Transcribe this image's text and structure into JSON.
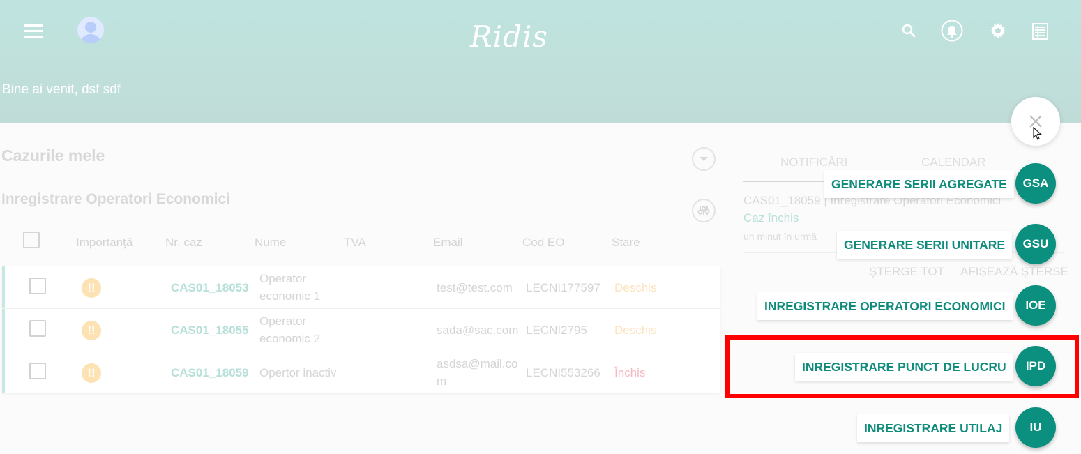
{
  "header": {
    "logo": "Ridis",
    "welcome": "Bine ai venit, dsf sdf"
  },
  "cases": {
    "title": "Cazurile mele",
    "section_title": "Inregistrare Operatori Economici",
    "columns": [
      "Importanță",
      "Nr. caz",
      "Nume",
      "TVA",
      "Email",
      "Cod EO",
      "Stare"
    ],
    "rows": [
      {
        "case": "CAS01_18053",
        "name_l1": "Operator",
        "name_l2": "economic 1",
        "email_l1": "test@test.com",
        "email_l2": "",
        "code": "LECNI177597",
        "status": "Deschis"
      },
      {
        "case": "CAS01_18055",
        "name_l1": "Operator",
        "name_l2": "economic 2",
        "email_l1": "sada@sac.com",
        "email_l2": "",
        "code": "LECNI2795",
        "status": "Deschis"
      },
      {
        "case": "CAS01_18059",
        "name_l1": "Opertor inactiv",
        "name_l2": "",
        "email_l1": "asdsa@mail.co",
        "email_l2": "m",
        "code": "LECNI553266",
        "status": "Închis"
      }
    ],
    "importance_glyph": "!!"
  },
  "notifications": {
    "tab_notifications": "NOTIFICĂRI",
    "tab_calendar": "CALENDAR",
    "item_text": "CAS01_18059 | Inregistrare Operatori Economici",
    "item_status": "Caz închis",
    "item_time": "un minut în urmă",
    "clear_all": "ȘTERGE TOT",
    "show_deleted": "AFIȘEAZĂ ȘTERSE"
  },
  "fab_menu": {
    "items": [
      {
        "abbr": "GSA",
        "label": "GENERARE SERII AGREGATE"
      },
      {
        "abbr": "GSU",
        "label": "GENERARE SERII UNITARE"
      },
      {
        "abbr": "IOE",
        "label": "INREGISTRARE OPERATORI ECONOMICI"
      },
      {
        "abbr": "IPD",
        "label": "INREGISTRARE PUNCT DE LUCRU"
      },
      {
        "abbr": "IU",
        "label": "INREGISTRARE UTILAJ"
      }
    ],
    "accent_color": "#0b8f7e",
    "highlight_color": "#ff0000"
  }
}
